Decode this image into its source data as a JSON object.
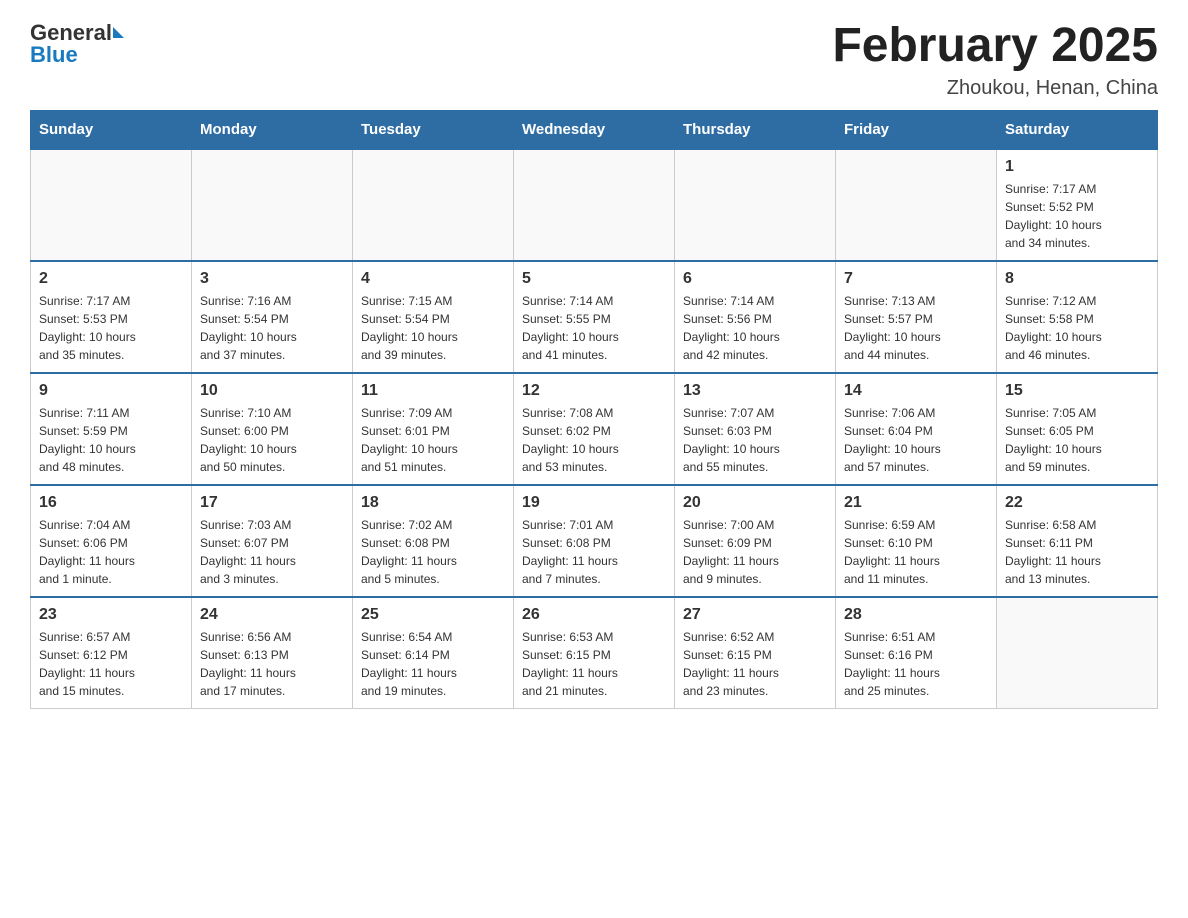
{
  "header": {
    "logo_general": "General",
    "logo_blue": "Blue",
    "title": "February 2025",
    "subtitle": "Zhoukou, Henan, China"
  },
  "days_of_week": [
    "Sunday",
    "Monday",
    "Tuesday",
    "Wednesday",
    "Thursday",
    "Friday",
    "Saturday"
  ],
  "weeks": [
    [
      {
        "day": "",
        "info": ""
      },
      {
        "day": "",
        "info": ""
      },
      {
        "day": "",
        "info": ""
      },
      {
        "day": "",
        "info": ""
      },
      {
        "day": "",
        "info": ""
      },
      {
        "day": "",
        "info": ""
      },
      {
        "day": "1",
        "info": "Sunrise: 7:17 AM\nSunset: 5:52 PM\nDaylight: 10 hours\nand 34 minutes."
      }
    ],
    [
      {
        "day": "2",
        "info": "Sunrise: 7:17 AM\nSunset: 5:53 PM\nDaylight: 10 hours\nand 35 minutes."
      },
      {
        "day": "3",
        "info": "Sunrise: 7:16 AM\nSunset: 5:54 PM\nDaylight: 10 hours\nand 37 minutes."
      },
      {
        "day": "4",
        "info": "Sunrise: 7:15 AM\nSunset: 5:54 PM\nDaylight: 10 hours\nand 39 minutes."
      },
      {
        "day": "5",
        "info": "Sunrise: 7:14 AM\nSunset: 5:55 PM\nDaylight: 10 hours\nand 41 minutes."
      },
      {
        "day": "6",
        "info": "Sunrise: 7:14 AM\nSunset: 5:56 PM\nDaylight: 10 hours\nand 42 minutes."
      },
      {
        "day": "7",
        "info": "Sunrise: 7:13 AM\nSunset: 5:57 PM\nDaylight: 10 hours\nand 44 minutes."
      },
      {
        "day": "8",
        "info": "Sunrise: 7:12 AM\nSunset: 5:58 PM\nDaylight: 10 hours\nand 46 minutes."
      }
    ],
    [
      {
        "day": "9",
        "info": "Sunrise: 7:11 AM\nSunset: 5:59 PM\nDaylight: 10 hours\nand 48 minutes."
      },
      {
        "day": "10",
        "info": "Sunrise: 7:10 AM\nSunset: 6:00 PM\nDaylight: 10 hours\nand 50 minutes."
      },
      {
        "day": "11",
        "info": "Sunrise: 7:09 AM\nSunset: 6:01 PM\nDaylight: 10 hours\nand 51 minutes."
      },
      {
        "day": "12",
        "info": "Sunrise: 7:08 AM\nSunset: 6:02 PM\nDaylight: 10 hours\nand 53 minutes."
      },
      {
        "day": "13",
        "info": "Sunrise: 7:07 AM\nSunset: 6:03 PM\nDaylight: 10 hours\nand 55 minutes."
      },
      {
        "day": "14",
        "info": "Sunrise: 7:06 AM\nSunset: 6:04 PM\nDaylight: 10 hours\nand 57 minutes."
      },
      {
        "day": "15",
        "info": "Sunrise: 7:05 AM\nSunset: 6:05 PM\nDaylight: 10 hours\nand 59 minutes."
      }
    ],
    [
      {
        "day": "16",
        "info": "Sunrise: 7:04 AM\nSunset: 6:06 PM\nDaylight: 11 hours\nand 1 minute."
      },
      {
        "day": "17",
        "info": "Sunrise: 7:03 AM\nSunset: 6:07 PM\nDaylight: 11 hours\nand 3 minutes."
      },
      {
        "day": "18",
        "info": "Sunrise: 7:02 AM\nSunset: 6:08 PM\nDaylight: 11 hours\nand 5 minutes."
      },
      {
        "day": "19",
        "info": "Sunrise: 7:01 AM\nSunset: 6:08 PM\nDaylight: 11 hours\nand 7 minutes."
      },
      {
        "day": "20",
        "info": "Sunrise: 7:00 AM\nSunset: 6:09 PM\nDaylight: 11 hours\nand 9 minutes."
      },
      {
        "day": "21",
        "info": "Sunrise: 6:59 AM\nSunset: 6:10 PM\nDaylight: 11 hours\nand 11 minutes."
      },
      {
        "day": "22",
        "info": "Sunrise: 6:58 AM\nSunset: 6:11 PM\nDaylight: 11 hours\nand 13 minutes."
      }
    ],
    [
      {
        "day": "23",
        "info": "Sunrise: 6:57 AM\nSunset: 6:12 PM\nDaylight: 11 hours\nand 15 minutes."
      },
      {
        "day": "24",
        "info": "Sunrise: 6:56 AM\nSunset: 6:13 PM\nDaylight: 11 hours\nand 17 minutes."
      },
      {
        "day": "25",
        "info": "Sunrise: 6:54 AM\nSunset: 6:14 PM\nDaylight: 11 hours\nand 19 minutes."
      },
      {
        "day": "26",
        "info": "Sunrise: 6:53 AM\nSunset: 6:15 PM\nDaylight: 11 hours\nand 21 minutes."
      },
      {
        "day": "27",
        "info": "Sunrise: 6:52 AM\nSunset: 6:15 PM\nDaylight: 11 hours\nand 23 minutes."
      },
      {
        "day": "28",
        "info": "Sunrise: 6:51 AM\nSunset: 6:16 PM\nDaylight: 11 hours\nand 25 minutes."
      },
      {
        "day": "",
        "info": ""
      }
    ]
  ]
}
